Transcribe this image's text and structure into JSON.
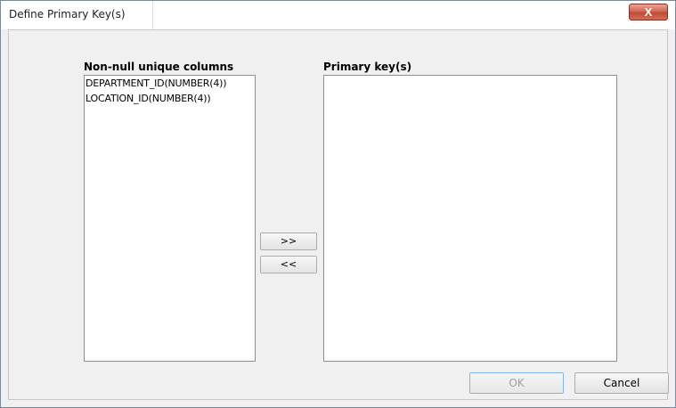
{
  "window": {
    "title": "Define Primary Key(s)",
    "close_label": "X"
  },
  "columns_panel": {
    "label": "Non-null unique columns",
    "items": [
      {
        "label": "DEPARTMENT_ID(NUMBER(4))"
      },
      {
        "label": "LOCATION_ID(NUMBER(4))"
      }
    ]
  },
  "keys_panel": {
    "label": "Primary key(s)",
    "items": []
  },
  "actions": {
    "add_label": ">>",
    "remove_label": "<<"
  },
  "footer": {
    "ok_label": "OK",
    "ok_enabled": false,
    "cancel_label": "Cancel"
  }
}
